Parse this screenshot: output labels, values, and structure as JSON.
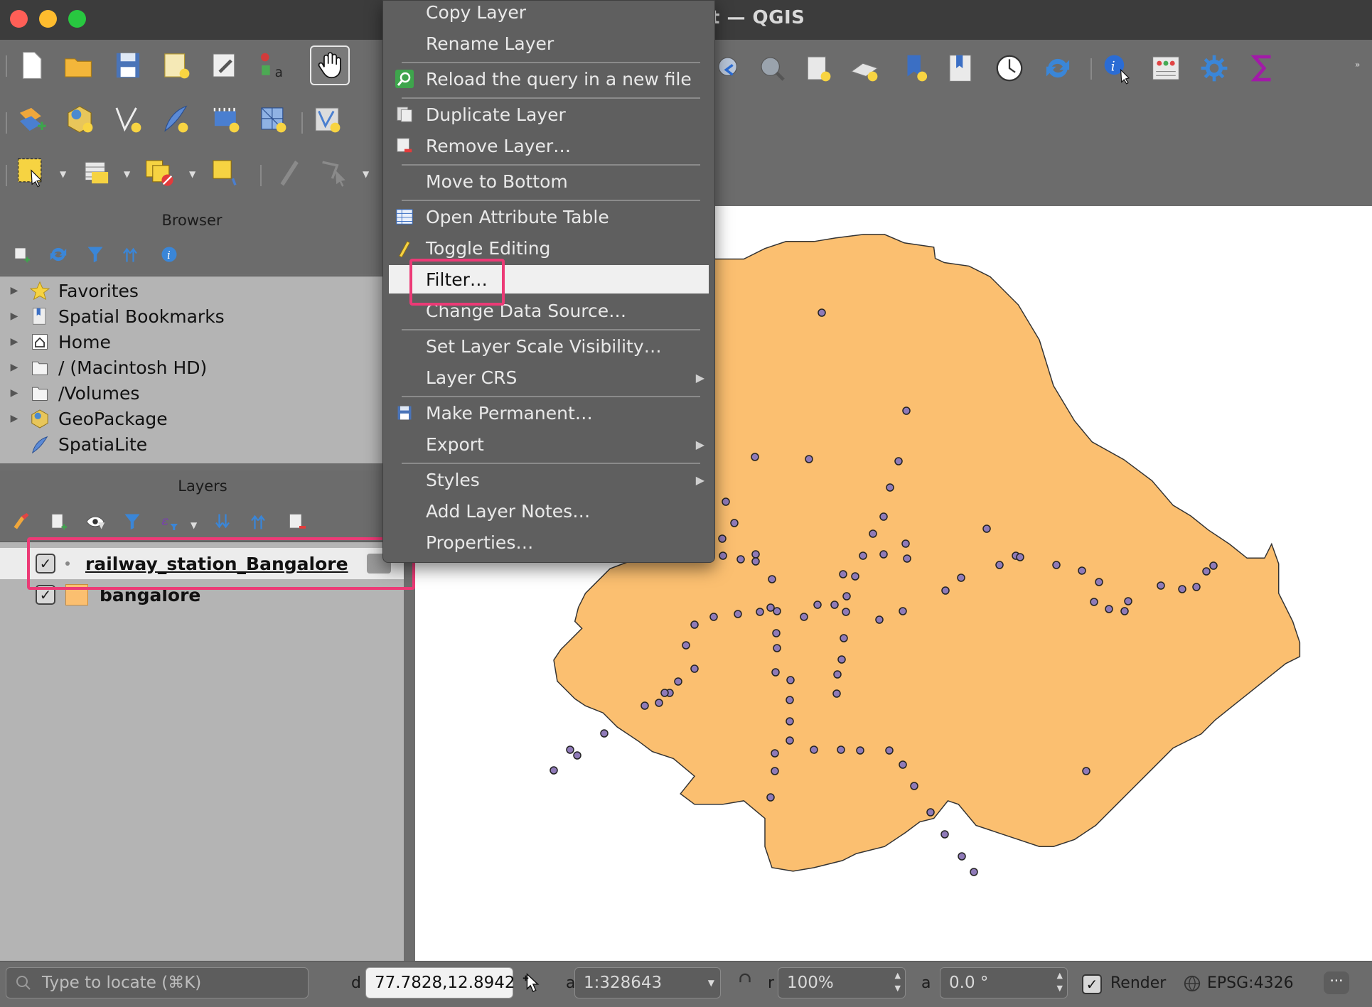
{
  "window": {
    "title_visible": "t — QGIS"
  },
  "panels": {
    "browser_title": "Browser",
    "layers_title": "Layers"
  },
  "browser": {
    "items": [
      {
        "label": "Favorites",
        "icon": "star-icon"
      },
      {
        "label": "Spatial Bookmarks",
        "icon": "bookmark-icon"
      },
      {
        "label": "Home",
        "icon": "home-icon"
      },
      {
        "label": "/ (Macintosh HD)",
        "icon": "folder-icon"
      },
      {
        "label": "/Volumes",
        "icon": "folder-icon"
      },
      {
        "label": "GeoPackage",
        "icon": "geopackage-icon"
      },
      {
        "label": "SpatiaLite",
        "icon": "spatialite-icon"
      }
    ]
  },
  "layers": {
    "items": [
      {
        "label": "railway_station_Bangalore",
        "checked": true,
        "selected": true
      },
      {
        "label": "bangalore",
        "checked": true,
        "selected": false,
        "swatch": "#fbbf70"
      }
    ]
  },
  "context_menu": {
    "items": [
      {
        "label": "Copy Layer"
      },
      {
        "label": "Rename Layer"
      },
      {
        "label": "Reload the query in a new file"
      },
      {
        "label": "Duplicate Layer"
      },
      {
        "label": "Remove Layer…"
      },
      {
        "label": "Move to Bottom"
      },
      {
        "label": "Open Attribute Table"
      },
      {
        "label": "Toggle Editing"
      },
      {
        "label": "Filter…",
        "highlighted": true
      },
      {
        "label": "Change Data Source…"
      },
      {
        "label": "Set Layer Scale Visibility…"
      },
      {
        "label": "Layer CRS"
      },
      {
        "label": "Make Permanent…"
      },
      {
        "label": "Export"
      },
      {
        "label": "Styles"
      },
      {
        "label": "Add Layer Notes…"
      },
      {
        "label": "Properties…"
      }
    ]
  },
  "statusbar": {
    "locate_placeholder": "Type to locate (⌘K)",
    "coordinate_label": "d",
    "coordinate": "77.7828,12.8942",
    "scale_label": "a",
    "scale": "1:328643",
    "magnifier_label": "r",
    "magnifier": "100%",
    "rotation_label": "a",
    "rotation": "0.0 °",
    "render_label": "Render",
    "crs": "EPSG:4326"
  },
  "colors": {
    "accent_highlight": "#ec3a76",
    "polygon_fill": "#fbbf70",
    "point_fill": "#8f7ab8",
    "panel_bg": "#b4b4b4"
  }
}
